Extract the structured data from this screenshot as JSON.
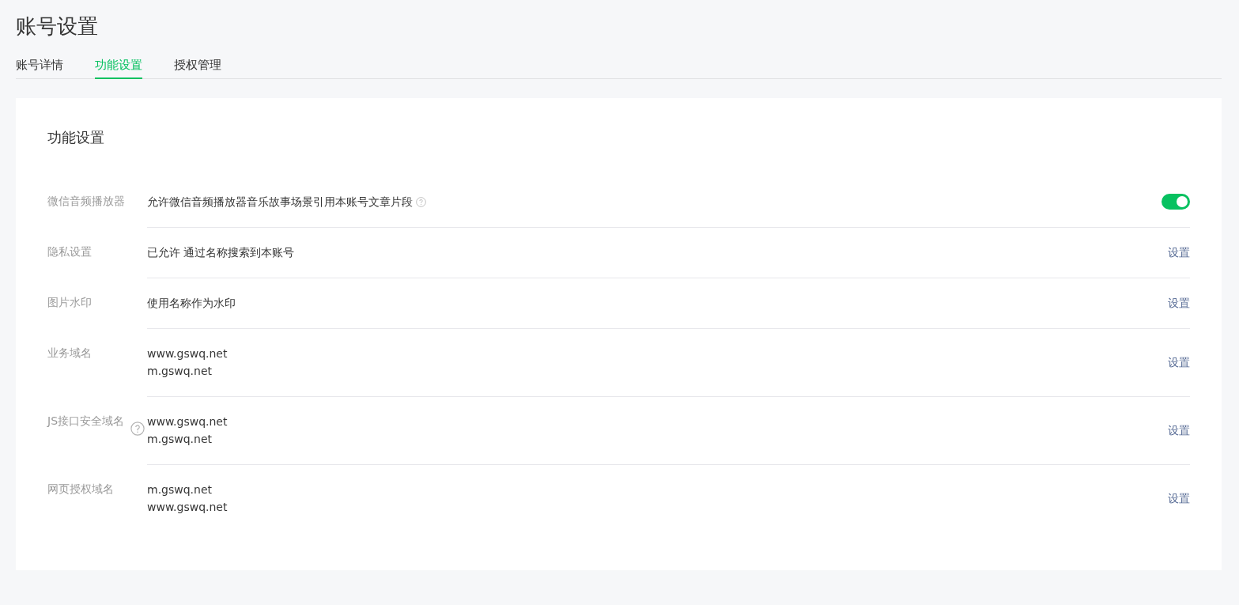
{
  "page": {
    "title": "账号设置"
  },
  "tabs": [
    {
      "label": "账号详情",
      "selected": false
    },
    {
      "label": "功能设置",
      "selected": true
    },
    {
      "label": "授权管理",
      "selected": false
    }
  ],
  "section": {
    "title": "功能设置",
    "rows": [
      {
        "label": "微信音频播放器",
        "label_help": false,
        "values": [
          "允许微信音频播放器音乐故事场景引用本账号文章片段"
        ],
        "value_help": true,
        "kind": "toggle",
        "on": true
      },
      {
        "label": "隐私设置",
        "label_help": false,
        "values": [
          "已允许 通过名称搜索到本账号"
        ],
        "value_help": false,
        "kind": "link",
        "action": "设置"
      },
      {
        "label": "图片水印",
        "label_help": false,
        "values": [
          "使用名称作为水印"
        ],
        "value_help": false,
        "kind": "link",
        "action": "设置"
      },
      {
        "label": "业务域名",
        "label_help": false,
        "values": [
          "www.gswq.net",
          "m.gswq.net"
        ],
        "value_help": false,
        "kind": "link",
        "action": "设置"
      },
      {
        "label": "JS接口安全域名",
        "label_help": true,
        "values": [
          "www.gswq.net",
          "m.gswq.net"
        ],
        "value_help": false,
        "kind": "link",
        "action": "设置"
      },
      {
        "label": "网页授权域名",
        "label_help": false,
        "values": [
          "m.gswq.net",
          "www.gswq.net"
        ],
        "value_help": false,
        "kind": "link",
        "action": "设置"
      }
    ]
  }
}
